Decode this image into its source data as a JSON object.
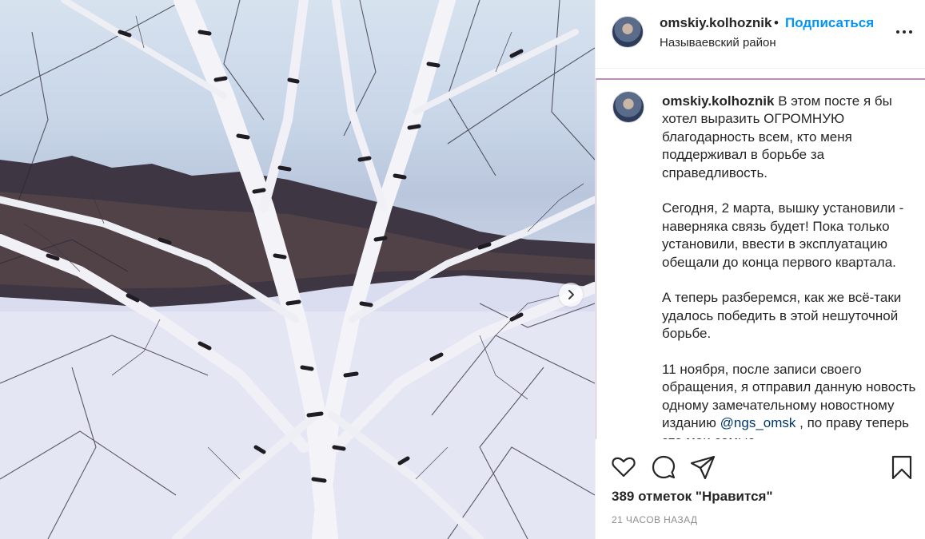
{
  "post": {
    "username": "omskiy.kolhoznik",
    "header_username": "omskiy.kolhoznik",
    "separator": "•",
    "follow_label": "Подписаться",
    "location": "Называевский район"
  },
  "caption": {
    "username": "omskiy.kolhoznik",
    "paragraph_1": "В этом посте я бы хотел выразить ОГРОМНУЮ благодарность всем, кто меня поддерживал в борьбе за справедливость.",
    "paragraph_2": "Сегодня, 2 марта, вышку установили - наверняка связь будет! Пока только установили, ввести в эксплуатацию обещали до конца первого квартала.",
    "paragraph_3": "А теперь разберемся, как же всё-таки удалось победить в этой нешуточной борьбе.",
    "paragraph_4_start": "11 ноября, после записи своего обращения, я отправил данную новость одному замечательному новостному изданию",
    "mention": "@ngs_omsk",
    "paragraph_4_end": ", по праву теперь это мои самые"
  },
  "stats": {
    "likes_label": "389 отметок \"Нравится\"",
    "timestamp": "21 ЧАСОВ НАЗАД"
  },
  "icons": {
    "like": "heart-icon",
    "comment": "comment-icon",
    "share": "paper-plane-icon",
    "save": "bookmark-icon",
    "more": "ellipsis-icon",
    "next": "chevron-right-icon"
  },
  "colors": {
    "accent": "#0095f6",
    "text": "#262626",
    "muted": "#8e8e8e",
    "mention": "#00376b"
  }
}
